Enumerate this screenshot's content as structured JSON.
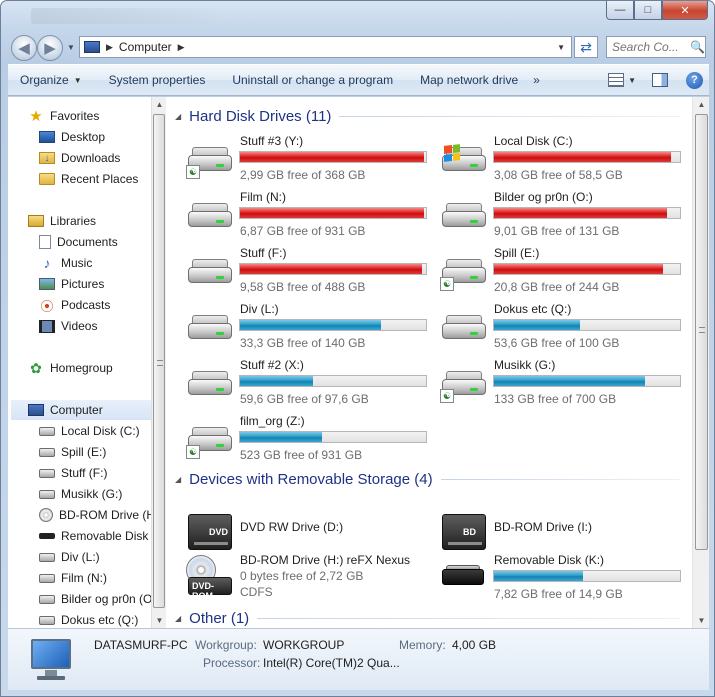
{
  "address": {
    "crumbs": [
      "Computer"
    ],
    "search_placeholder": "Search Co..."
  },
  "toolbar": {
    "organize": "Organize",
    "system_properties": "System properties",
    "uninstall": "Uninstall or change a program",
    "map_network": "Map network drive",
    "more": "»"
  },
  "nav": {
    "favorites": "Favorites",
    "desktop": "Desktop",
    "downloads": "Downloads",
    "recent_places": "Recent Places",
    "libraries": "Libraries",
    "documents": "Documents",
    "music": "Music",
    "pictures": "Pictures",
    "podcasts": "Podcasts",
    "videos": "Videos",
    "homegroup": "Homegroup",
    "computer": "Computer",
    "drives": [
      "Local Disk (C:)",
      "Spill (E:)",
      "Stuff (F:)",
      "Musikk (G:)",
      "BD-ROM Drive (H:",
      "Removable Disk (",
      "Div (L:)",
      "Film (N:)",
      "Bilder og pr0n (O",
      "Dokus etc (Q:)"
    ]
  },
  "groups": {
    "hdd": "Hard Disk Drives (11)",
    "removable": "Devices with Removable Storage (4)",
    "other": "Other (1)"
  },
  "hdd": [
    {
      "name": "Stuff #3 (Y:)",
      "free": "2,99 GB free of 368 GB",
      "used_fraction": 0.99,
      "color": "red"
    },
    {
      "name": "Local Disk (C:)",
      "free": "3,08 GB free of 58,5 GB",
      "used_fraction": 0.95,
      "color": "red"
    },
    {
      "name": "Film (N:)",
      "free": "6,87 GB free of 931 GB",
      "used_fraction": 0.99,
      "color": "red"
    },
    {
      "name": "Bilder og pr0n (O:)",
      "free": "9,01 GB free of 131 GB",
      "used_fraction": 0.93,
      "color": "red"
    },
    {
      "name": "Stuff (F:)",
      "free": "9,58 GB free of 488 GB",
      "used_fraction": 0.98,
      "color": "red"
    },
    {
      "name": "Spill (E:)",
      "free": "20,8 GB free of 244 GB",
      "used_fraction": 0.91,
      "color": "red"
    },
    {
      "name": "Div (L:)",
      "free": "33,3 GB free of 140 GB",
      "used_fraction": 0.76,
      "color": "blue"
    },
    {
      "name": "Dokus etc (Q:)",
      "free": "53,6 GB free of 100 GB",
      "used_fraction": 0.46,
      "color": "blue"
    },
    {
      "name": "Stuff #2 (X:)",
      "free": "59,6 GB free of 97,6 GB",
      "used_fraction": 0.39,
      "color": "blue"
    },
    {
      "name": "Musikk (G:)",
      "free": "133 GB free of 700 GB",
      "used_fraction": 0.81,
      "color": "blue"
    },
    {
      "name": "film_org (Z:)",
      "free": "523 GB free of 931 GB",
      "used_fraction": 0.44,
      "color": "blue"
    }
  ],
  "removable": {
    "dvd": {
      "name": "DVD RW Drive (D:)",
      "label": "DVD"
    },
    "bd": {
      "name": "BD-ROM Drive (I:)",
      "label": "BD"
    },
    "bdh": {
      "name": "BD-ROM Drive (H:) reFX Nexus",
      "free": "0 bytes free of 2,72 GB",
      "fs": "CDFS",
      "label": "DVD-ROM"
    },
    "rem": {
      "name": "Removable Disk (K:)",
      "free": "7,82 GB free of 14,9 GB",
      "used_fraction": 0.48
    }
  },
  "details": {
    "pc_name": "DATASMURF-PC",
    "workgroup_label": "Workgroup:",
    "workgroup": "WORKGROUP",
    "memory_label": "Memory:",
    "memory": "4,00 GB",
    "processor_label": "Processor:",
    "processor": "Intel(R) Core(TM)2 Qua..."
  }
}
